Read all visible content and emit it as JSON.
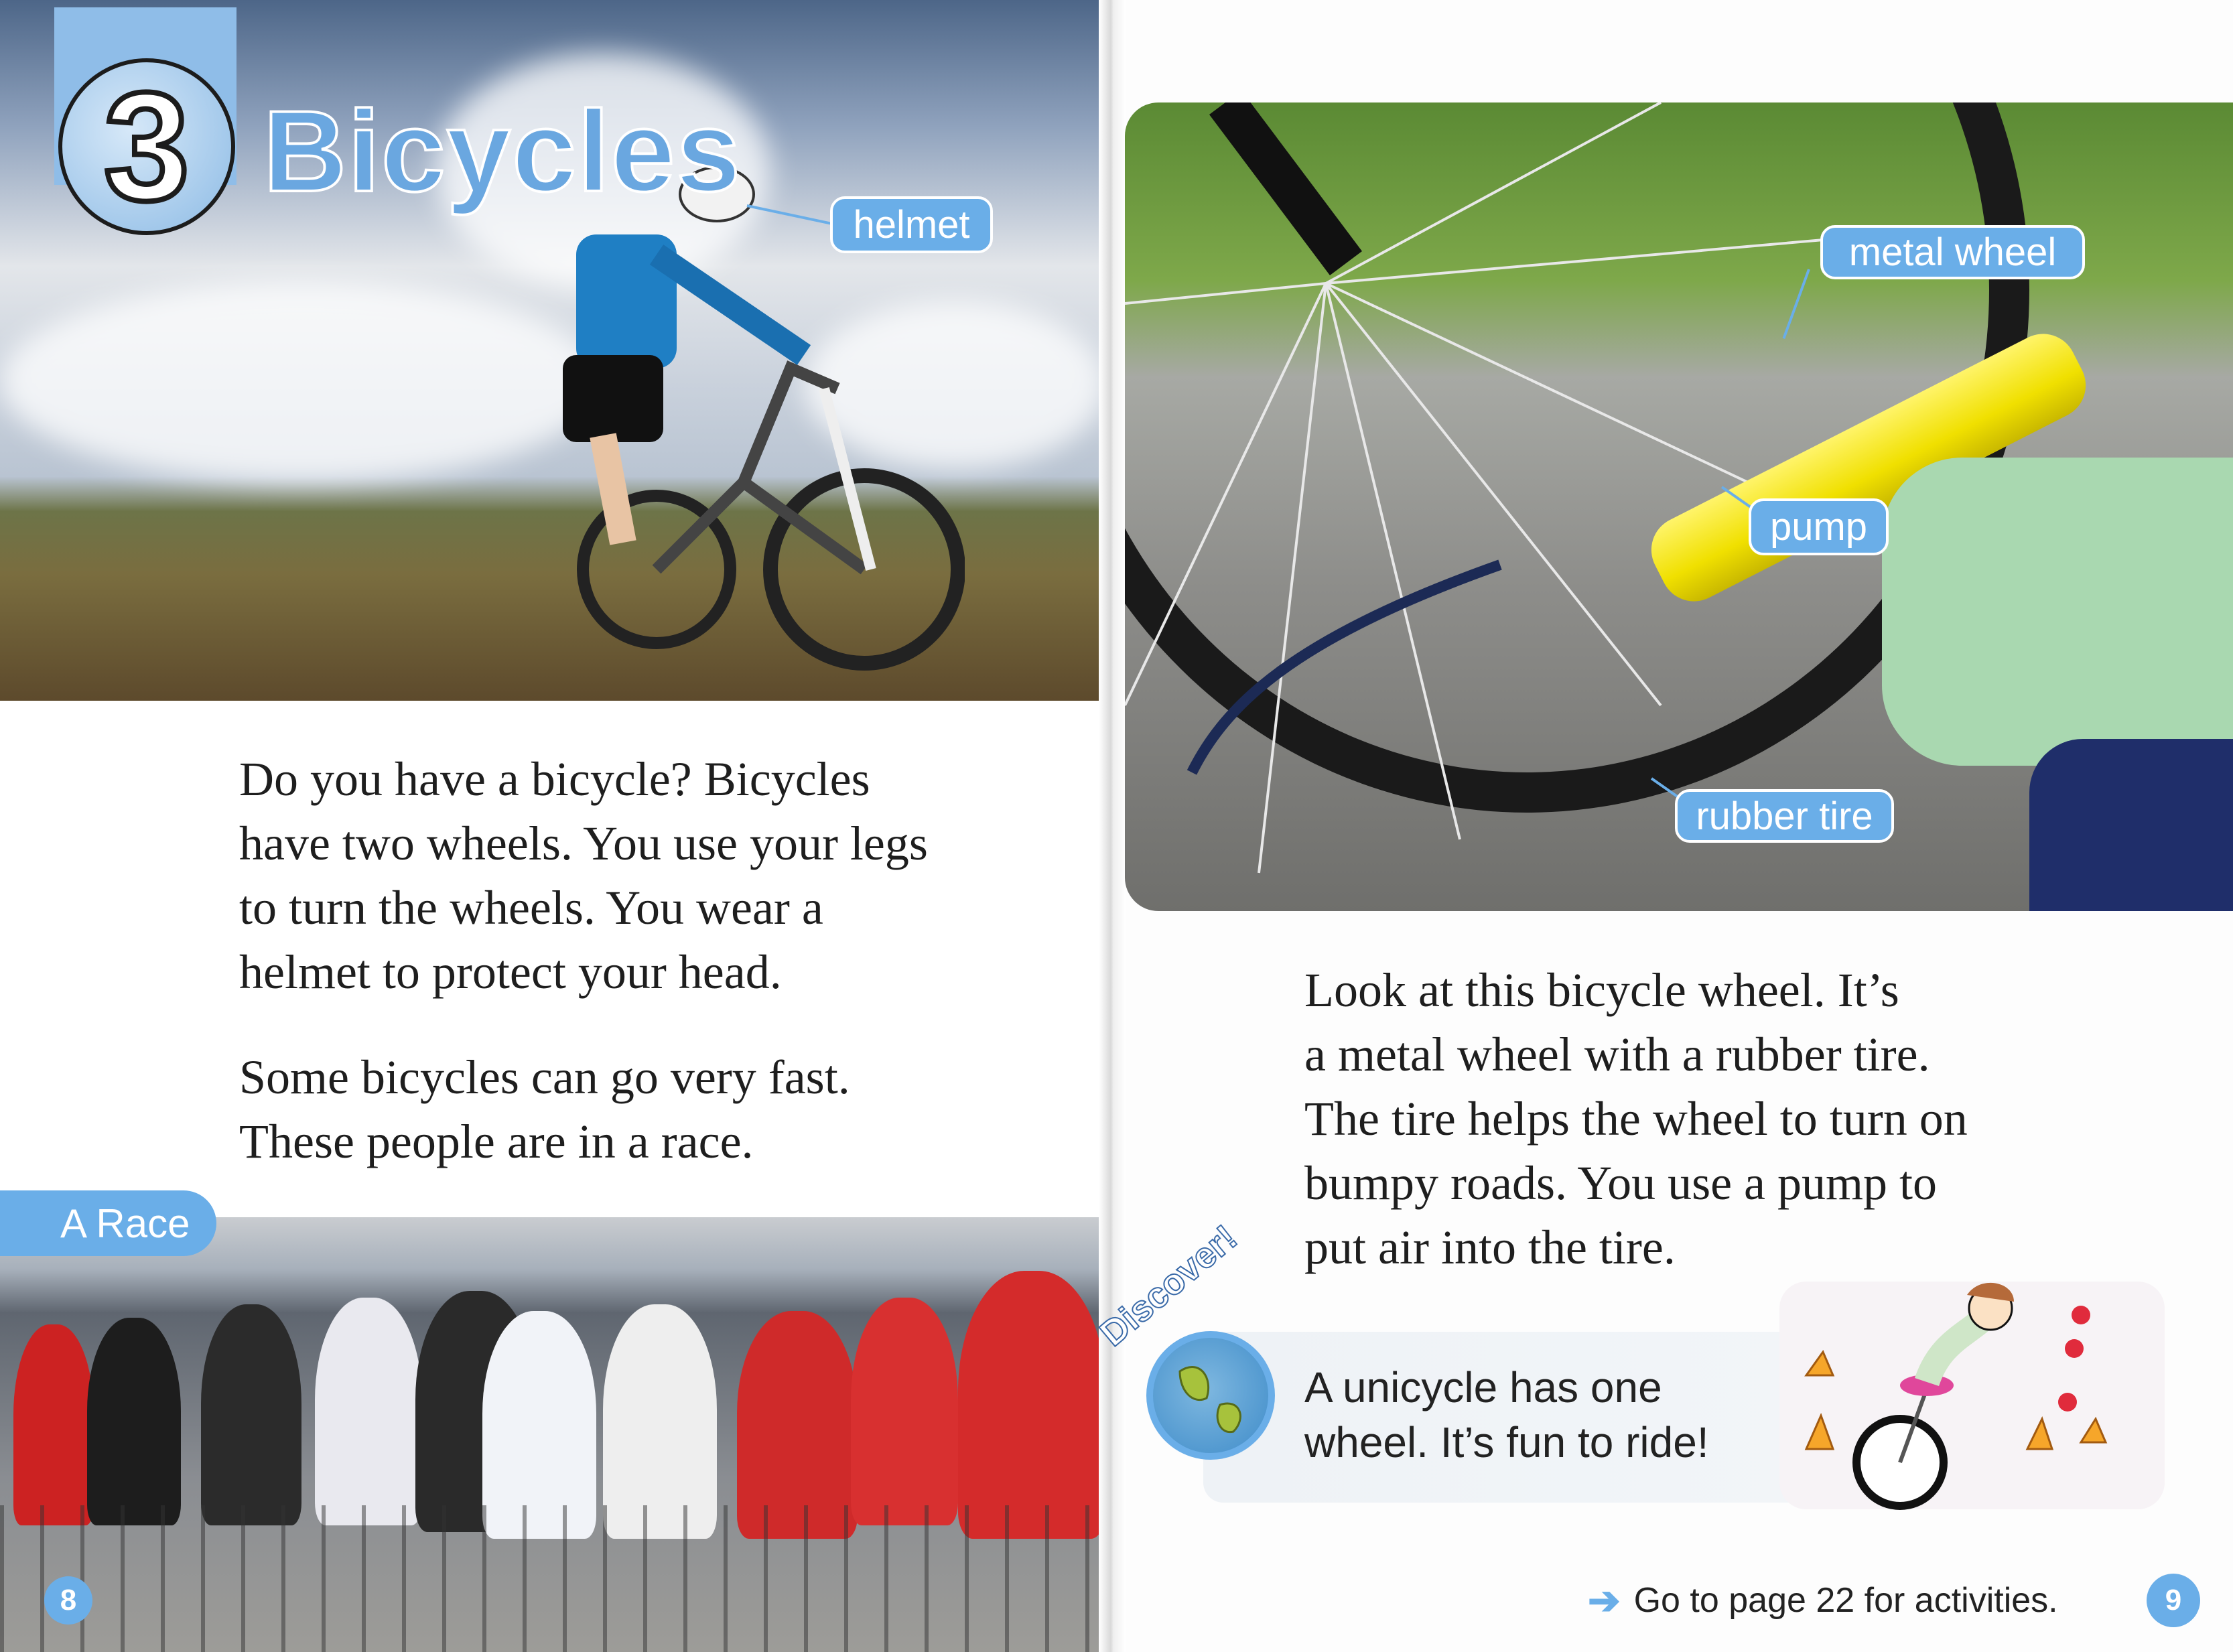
{
  "left_page": {
    "chapter_number": "3",
    "chapter_title": "Bicycles",
    "photo_labels": {
      "helmet": "helmet"
    },
    "paragraph1": [
      "Do you have a bicycle? Bicycles",
      "have two wheels. You use your legs",
      "to turn the wheels. You wear a",
      "helmet to protect your head."
    ],
    "paragraph2": [
      "Some bicycles can go very fast.",
      "These people are in a race."
    ],
    "section_tab": "A Race",
    "page_number": "8"
  },
  "right_page": {
    "photo_labels": {
      "metal_wheel": "metal wheel",
      "pump": "pump",
      "rubber_tire": "rubber tire"
    },
    "paragraph": [
      "Look at this bicycle wheel. It’s",
      "a metal wheel with a rubber tire.",
      "The tire helps the wheel to turn on",
      "bumpy roads. You use a pump to",
      "put air into the tire."
    ],
    "discover": {
      "badge": "Discover!",
      "text": [
        "A unicycle has one",
        "wheel. It’s fun to ride!"
      ]
    },
    "footer_link": "Go to page 22 for activities.",
    "page_number": "9"
  },
  "colors": {
    "accent_blue": "#6aaee8",
    "text": "#1e1e1e"
  }
}
